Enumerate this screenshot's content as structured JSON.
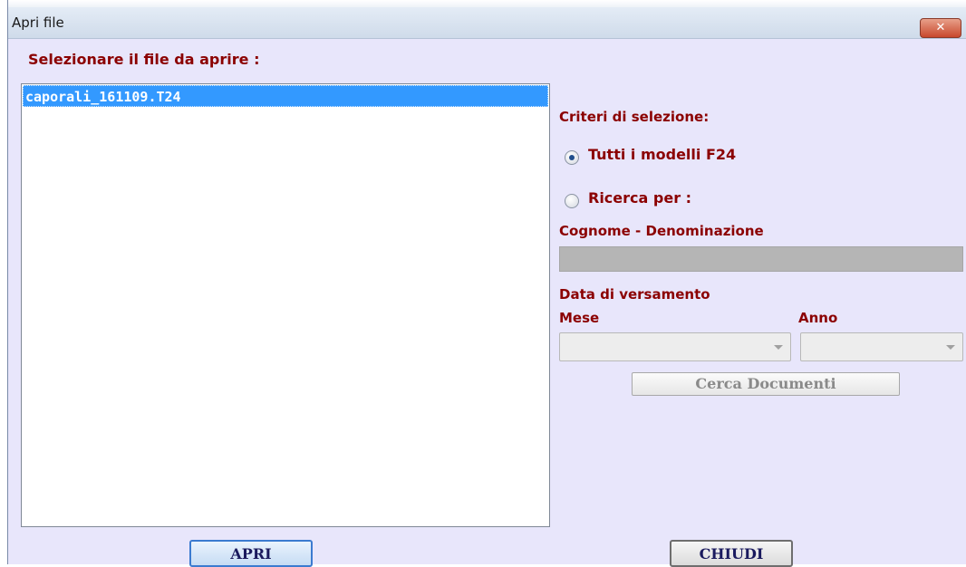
{
  "window": {
    "title": "Apri file",
    "close_icon": "close-icon",
    "close_label": "✕"
  },
  "file_panel": {
    "label": "Selezionare il file da aprire :",
    "files": [
      "caporali_161109.T24"
    ],
    "selected_index": 0
  },
  "criteria": {
    "heading": "Criteri di selezione:",
    "option_all": "Tutti i modelli F24",
    "option_search": "Ricerca per :",
    "selected_option": "all",
    "name_label": "Cognome - Denominazione",
    "name_value": "",
    "date_label": "Data di versamento",
    "month_label": "Mese",
    "month_value": "",
    "year_label": "Anno",
    "year_value": "",
    "search_button": "Cerca Documenti"
  },
  "footer": {
    "open_button": "APRI",
    "close_button": "CHIUDI"
  },
  "colors": {
    "dialog_bg": "#e8e6fb",
    "label_red": "#8b0000",
    "selection_blue": "#3399ff",
    "disabled_input": "#b5b5b5"
  }
}
